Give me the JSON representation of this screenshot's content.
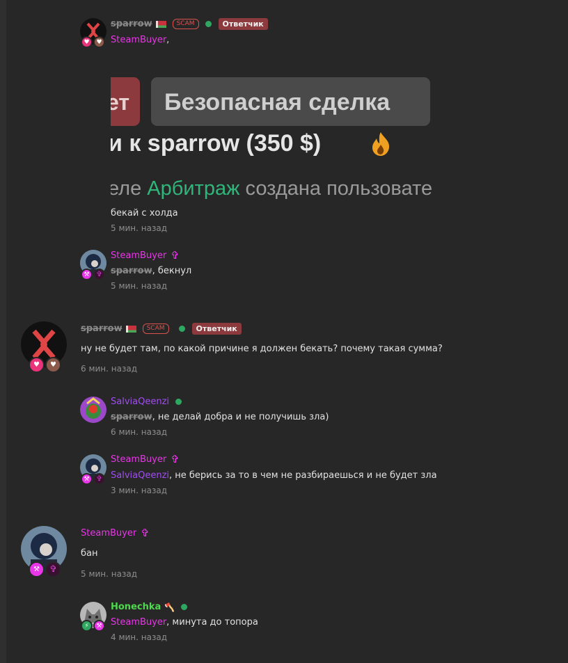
{
  "posts": [
    {
      "user": "sparrow",
      "scam": "SCAM",
      "role": "Ответчик",
      "mention": "SteamBuyer",
      "text": ",",
      "embed": {
        "red_btn": "ет",
        "gray_btn": "Безопасная сделка",
        "title": "и к sparrow (350 $)",
        "sub_a": "еле ",
        "sub_link": "Арбитраж",
        "sub_b": " создана пользовате"
      },
      "text2": "бекай с холда",
      "time": "5 мин. назад"
    },
    {
      "user": "SteamBuyer",
      "mention": "sparrow",
      "text": ", бекнул",
      "time": "5 мин. назад"
    },
    {
      "user": "sparrow",
      "scam": "SCAM",
      "role": "Ответчик",
      "text": "ну не будет там, по какой причине я должен бекать? почему такая сумма?",
      "time": "6 мин. назад"
    },
    {
      "user": "SalviaQeenzi",
      "mention": "sparrow",
      "text": ", не делай добра и не получишь зла)",
      "time": "6 мин. назад"
    },
    {
      "user": "SteamBuyer",
      "mention": "SalviaQeenzi",
      "text": ", не берись за то в чем не разбираешься и не будет зла",
      "time": "3 мин. назад"
    },
    {
      "user": "SteamBuyer",
      "text": "бан",
      "time": "5 мин. назад"
    },
    {
      "user": "Honechka",
      "mention": "SteamBuyer",
      "text": ", минута до топора",
      "time": "4 мин. назад"
    }
  ],
  "icons": {
    "heart": "heart-icon",
    "cross": "cross-icon",
    "hammer": "hammer-icon",
    "fire": "fire-icon",
    "online": "online-dot",
    "axe": "axe-icon",
    "bolt": "bolt-icon"
  },
  "colors": {
    "background": "#272727",
    "sparrow": "#8a8a8a",
    "steambuyer": "#e936e9",
    "salvia": "#a14df2",
    "honechka": "#4dd84d",
    "role_badge": "#8c3a3e",
    "online": "#2ea860",
    "scam": "#d9534f",
    "link_green": "#2fb67b"
  }
}
